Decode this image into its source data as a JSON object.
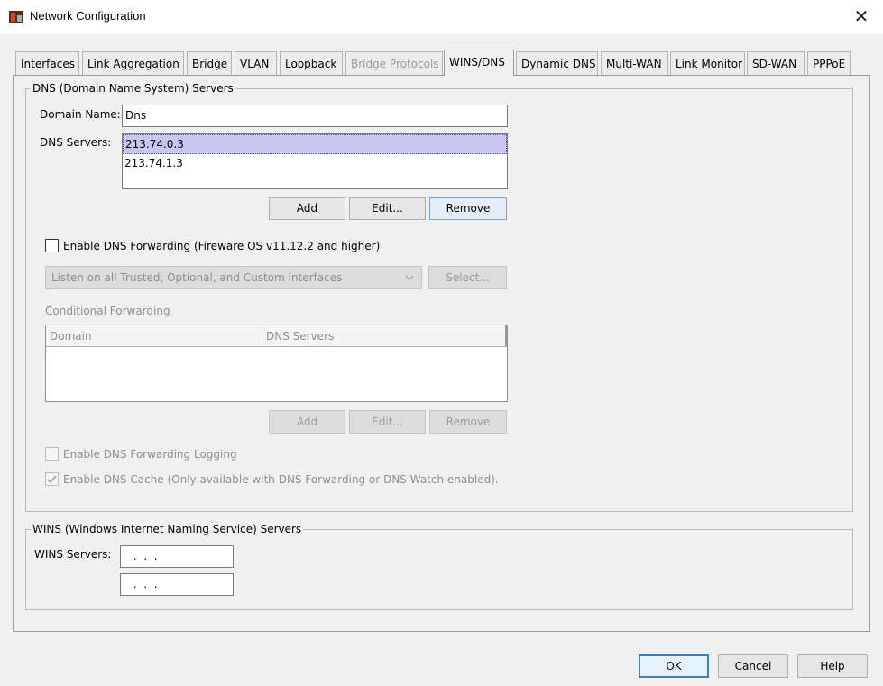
{
  "window": {
    "title": "Network Configuration",
    "close_glyph": "✕",
    "icon": "firebox-app-icon"
  },
  "tabs": [
    {
      "label": "Interfaces",
      "state": "normal"
    },
    {
      "label": "Link Aggregation",
      "state": "normal"
    },
    {
      "label": "Bridge",
      "state": "normal"
    },
    {
      "label": "VLAN",
      "state": "normal"
    },
    {
      "label": "Loopback",
      "state": "normal"
    },
    {
      "label": "Bridge Protocols",
      "state": "disabled"
    },
    {
      "label": "WINS/DNS",
      "state": "active"
    },
    {
      "label": "Dynamic DNS",
      "state": "normal"
    },
    {
      "label": "Multi-WAN",
      "state": "normal"
    },
    {
      "label": "Link Monitor",
      "state": "normal"
    },
    {
      "label": "SD-WAN",
      "state": "normal"
    },
    {
      "label": "PPPoE",
      "state": "normal"
    }
  ],
  "dns": {
    "legend": "DNS (Domain Name System) Servers",
    "domain_name_label": "Domain Name:",
    "domain_name_value": "Dns",
    "dns_servers_label": "DNS Servers:",
    "servers": [
      "213.74.0.3",
      "213.74.1.3"
    ],
    "add_label": "Add",
    "edit_label": "Edit...",
    "remove_label": "Remove",
    "forwarding_label": "Enable DNS Forwarding (Fireware OS v11.12.2 and higher)",
    "forwarding_checked": false,
    "listen_select_value": "Listen on all Trusted, Optional, and Custom interfaces",
    "select_button_label": "Select...",
    "conditional_label": "Conditional Forwarding",
    "cf_columns": [
      "Domain",
      "DNS Servers"
    ],
    "cf_add_label": "Add",
    "cf_edit_label": "Edit...",
    "cf_remove_label": "Remove",
    "logging_label": "Enable DNS Forwarding Logging",
    "logging_checked": false,
    "cache_label": "Enable DNS Cache (Only available with DNS Forwarding or DNS Watch enabled).",
    "cache_checked": true
  },
  "wins": {
    "legend": "WINS (Windows Internet Naming Service) Servers",
    "servers_label": "WINS Servers:",
    "server1": " .  .  . ",
    "server2": " .  .  . "
  },
  "footer": {
    "ok_label": "OK",
    "cancel_label": "Cancel",
    "help_label": "Help"
  }
}
